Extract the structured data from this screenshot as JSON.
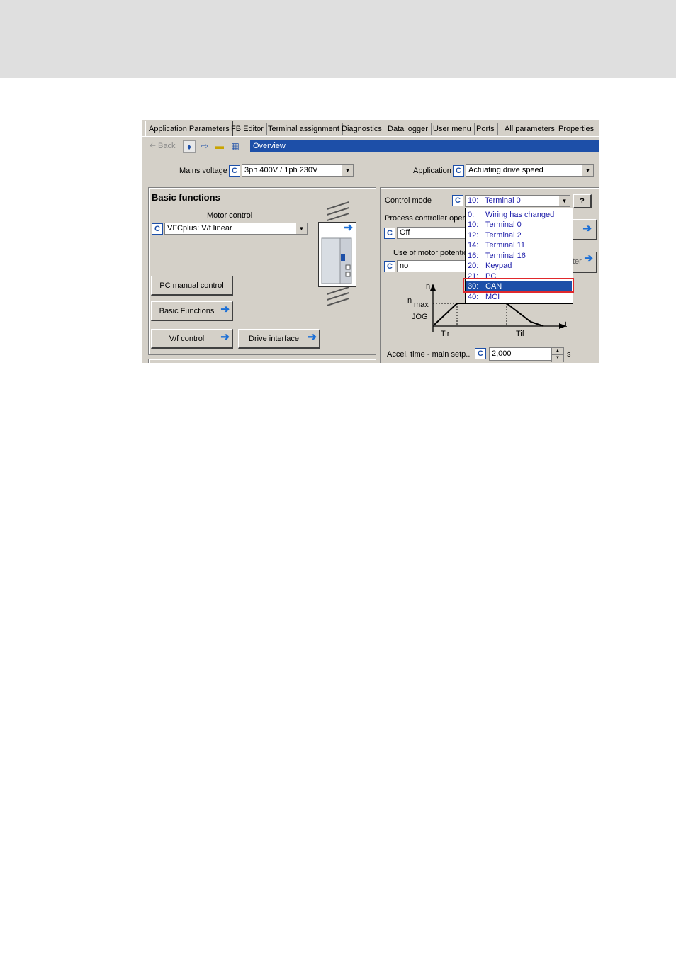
{
  "tabs": [
    "Application Parameters",
    "FB Editor",
    "Terminal assignment",
    "Diagnostics",
    "Data logger",
    "User menu",
    "Ports",
    "All parameters",
    "Properties"
  ],
  "toolbar": {
    "back_label": "Back",
    "overview_label": "Overview"
  },
  "mains_voltage": {
    "label": "Mains voltage",
    "badge": "C",
    "value": "3ph 400V / 1ph 230V"
  },
  "application": {
    "label": "Application",
    "badge": "C",
    "value": "Actuating drive speed"
  },
  "basic_functions": {
    "title": "Basic functions",
    "motor_control_label": "Motor control",
    "badge": "C",
    "motor_control_value": "VFCplus: V/f linear",
    "buttons": {
      "pc_manual": "PC manual control",
      "basic_functions": "Basic Functions",
      "vf_control": "V/f control",
      "drive_interface": "Drive interface"
    }
  },
  "control_mode": {
    "label": "Control mode",
    "badge": "C",
    "value_code": "10:",
    "value_name": "Terminal 0",
    "help": "?"
  },
  "process_controller": {
    "label": "Process controller operat",
    "badge": "C",
    "value": "Off"
  },
  "motor_potentiometer": {
    "label": "Use of motor potention",
    "badge": "C",
    "value": "no",
    "button_fragment": "ter"
  },
  "dropdown_options": [
    {
      "code": "0:",
      "name": "Wiring has changed"
    },
    {
      "code": "10:",
      "name": "Terminal 0"
    },
    {
      "code": "12:",
      "name": "Terminal 2"
    },
    {
      "code": "14:",
      "name": "Terminal 11"
    },
    {
      "code": "16:",
      "name": "Terminal 16"
    },
    {
      "code": "20:",
      "name": "Keypad"
    },
    {
      "code": "21:",
      "name": "PC"
    },
    {
      "code": "30:",
      "name": "CAN"
    },
    {
      "code": "40:",
      "name": "MCI"
    }
  ],
  "selected_option": "30: CAN",
  "diagram": {
    "n_label": "n",
    "nmax_label": "n",
    "max_sub": "max",
    "jog_label": "JOG",
    "tir_label": "Tir",
    "tif_label": "Tif",
    "t_label": "t"
  },
  "accel": {
    "label": "Accel. time - main setp..",
    "badge": "C",
    "value": "2,000",
    "unit": "s"
  },
  "colors": {
    "accent": "#1d4fa8",
    "highlight": "#e0282c",
    "panel": "#d4d0c8",
    "arrow": "#1b6fd6"
  }
}
